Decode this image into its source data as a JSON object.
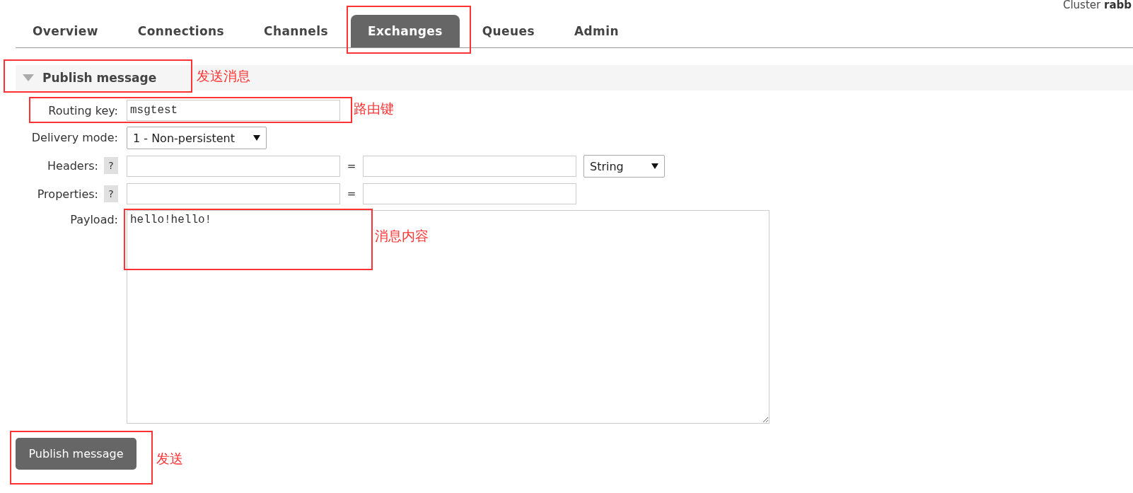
{
  "cluster": {
    "label": "Cluster",
    "name": "rabb"
  },
  "tabs": [
    {
      "label": "Overview",
      "selected": false
    },
    {
      "label": "Connections",
      "selected": false
    },
    {
      "label": "Channels",
      "selected": false
    },
    {
      "label": "Exchanges",
      "selected": true
    },
    {
      "label": "Queues",
      "selected": false
    },
    {
      "label": "Admin",
      "selected": false
    }
  ],
  "section": {
    "title": "Publish message",
    "expanded": true,
    "annotation": "发送消息"
  },
  "form": {
    "routing_key": {
      "label": "Routing key:",
      "value": "msgtest",
      "annotation": "路由键"
    },
    "delivery_mode": {
      "label": "Delivery mode:",
      "value": "1 - Non-persistent"
    },
    "headers": {
      "label": "Headers:",
      "help": "?",
      "equals": "=",
      "type": "String"
    },
    "properties": {
      "label": "Properties:",
      "help": "?",
      "equals": "="
    },
    "payload": {
      "label": "Payload:",
      "value": "hello!hello!",
      "annotation": "消息内容"
    }
  },
  "publish_button": {
    "label": "Publish message",
    "annotation": "发送"
  }
}
